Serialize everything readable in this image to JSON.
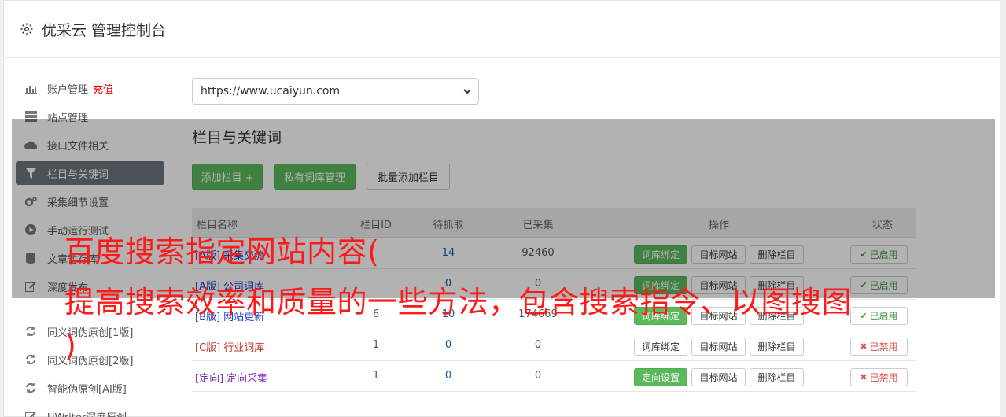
{
  "header": {
    "title": "优采云 管理控制台",
    "icon": "gear-icon"
  },
  "sidebar": {
    "items": [
      {
        "label": "账户管理",
        "extra": "充值",
        "icon": "bar-chart-icon"
      },
      {
        "label": "站点管理",
        "icon": "server-icon"
      },
      {
        "label": "接口文件相关",
        "icon": "cloud-upload-icon"
      },
      {
        "label": "栏目与关键词",
        "icon": "filter-icon",
        "active": true
      },
      {
        "label": "采集细节设置",
        "icon": "cogs-icon"
      },
      {
        "label": "手动运行测试",
        "icon": "play-circle-icon"
      },
      {
        "label": "文章暂存库",
        "icon": "database-icon"
      },
      {
        "label": "深度发布",
        "icon": "edit-icon"
      },
      {
        "label": "同义词伪原创[1版]",
        "icon": "refresh-icon"
      },
      {
        "label": "同义词伪原创[2版]",
        "icon": "refresh-icon"
      },
      {
        "label": "智能伪原创[AI版]",
        "icon": "refresh-icon"
      },
      {
        "label": "UWriter深度原创",
        "icon": "edit-icon"
      }
    ]
  },
  "site_select": {
    "value": "https://www.ucaiyun.com"
  },
  "section": {
    "title": "栏目与关键词",
    "add_button": "添加栏目 +",
    "private_button": "私有词库管理",
    "batch_button": "批量添加栏目"
  },
  "table": {
    "headers": [
      "栏目名称",
      "栏目ID",
      "待抓取",
      "已采集",
      "操作",
      "状态"
    ],
    "rows": [
      {
        "tag": "[A版]",
        "name": "采集交流",
        "id": "",
        "pending": "14",
        "collected": "92460",
        "op1": "词库绑定",
        "op2": "目标网站",
        "op3": "删除栏目",
        "status": "已启用",
        "on": true
      },
      {
        "tag": "[A版]",
        "name": "公司词库",
        "id": "",
        "pending": "0",
        "collected": "0",
        "op1": "词库绑定",
        "op2": "目标网站",
        "op3": "删除栏目",
        "status": "已启用",
        "on": true
      },
      {
        "tag": "[B版]",
        "name": "网站更新",
        "id": "6",
        "pending": "10",
        "collected": "174669",
        "op1": "词库绑定",
        "op2": "目标网站",
        "op3": "删除栏目",
        "status": "已启用",
        "on": true
      },
      {
        "tag": "[C版]",
        "name": "行业词库",
        "id": "1",
        "pending": "0",
        "collected": "0",
        "op1": "词库绑定",
        "op2": "目标网站",
        "op3": "删除栏目",
        "status": "已禁用",
        "on": false
      },
      {
        "tag": "[定向]",
        "name": "定向采集",
        "id": "1",
        "pending": "0",
        "collected": "0",
        "op1": "定向设置",
        "op2": "目标网站",
        "op3": "删除栏目",
        "status": "已禁用",
        "on": false
      }
    ]
  },
  "overlay": {
    "line1": "百度搜索指定网站内容(",
    "line2": "提高搜索效率和质量的一些方法，包含搜索指令、以图搜图",
    "line3": ")"
  },
  "colors": {
    "accent": "#5cb85c",
    "active": "#6c757d",
    "overlay_text": "#ff1a1a"
  }
}
